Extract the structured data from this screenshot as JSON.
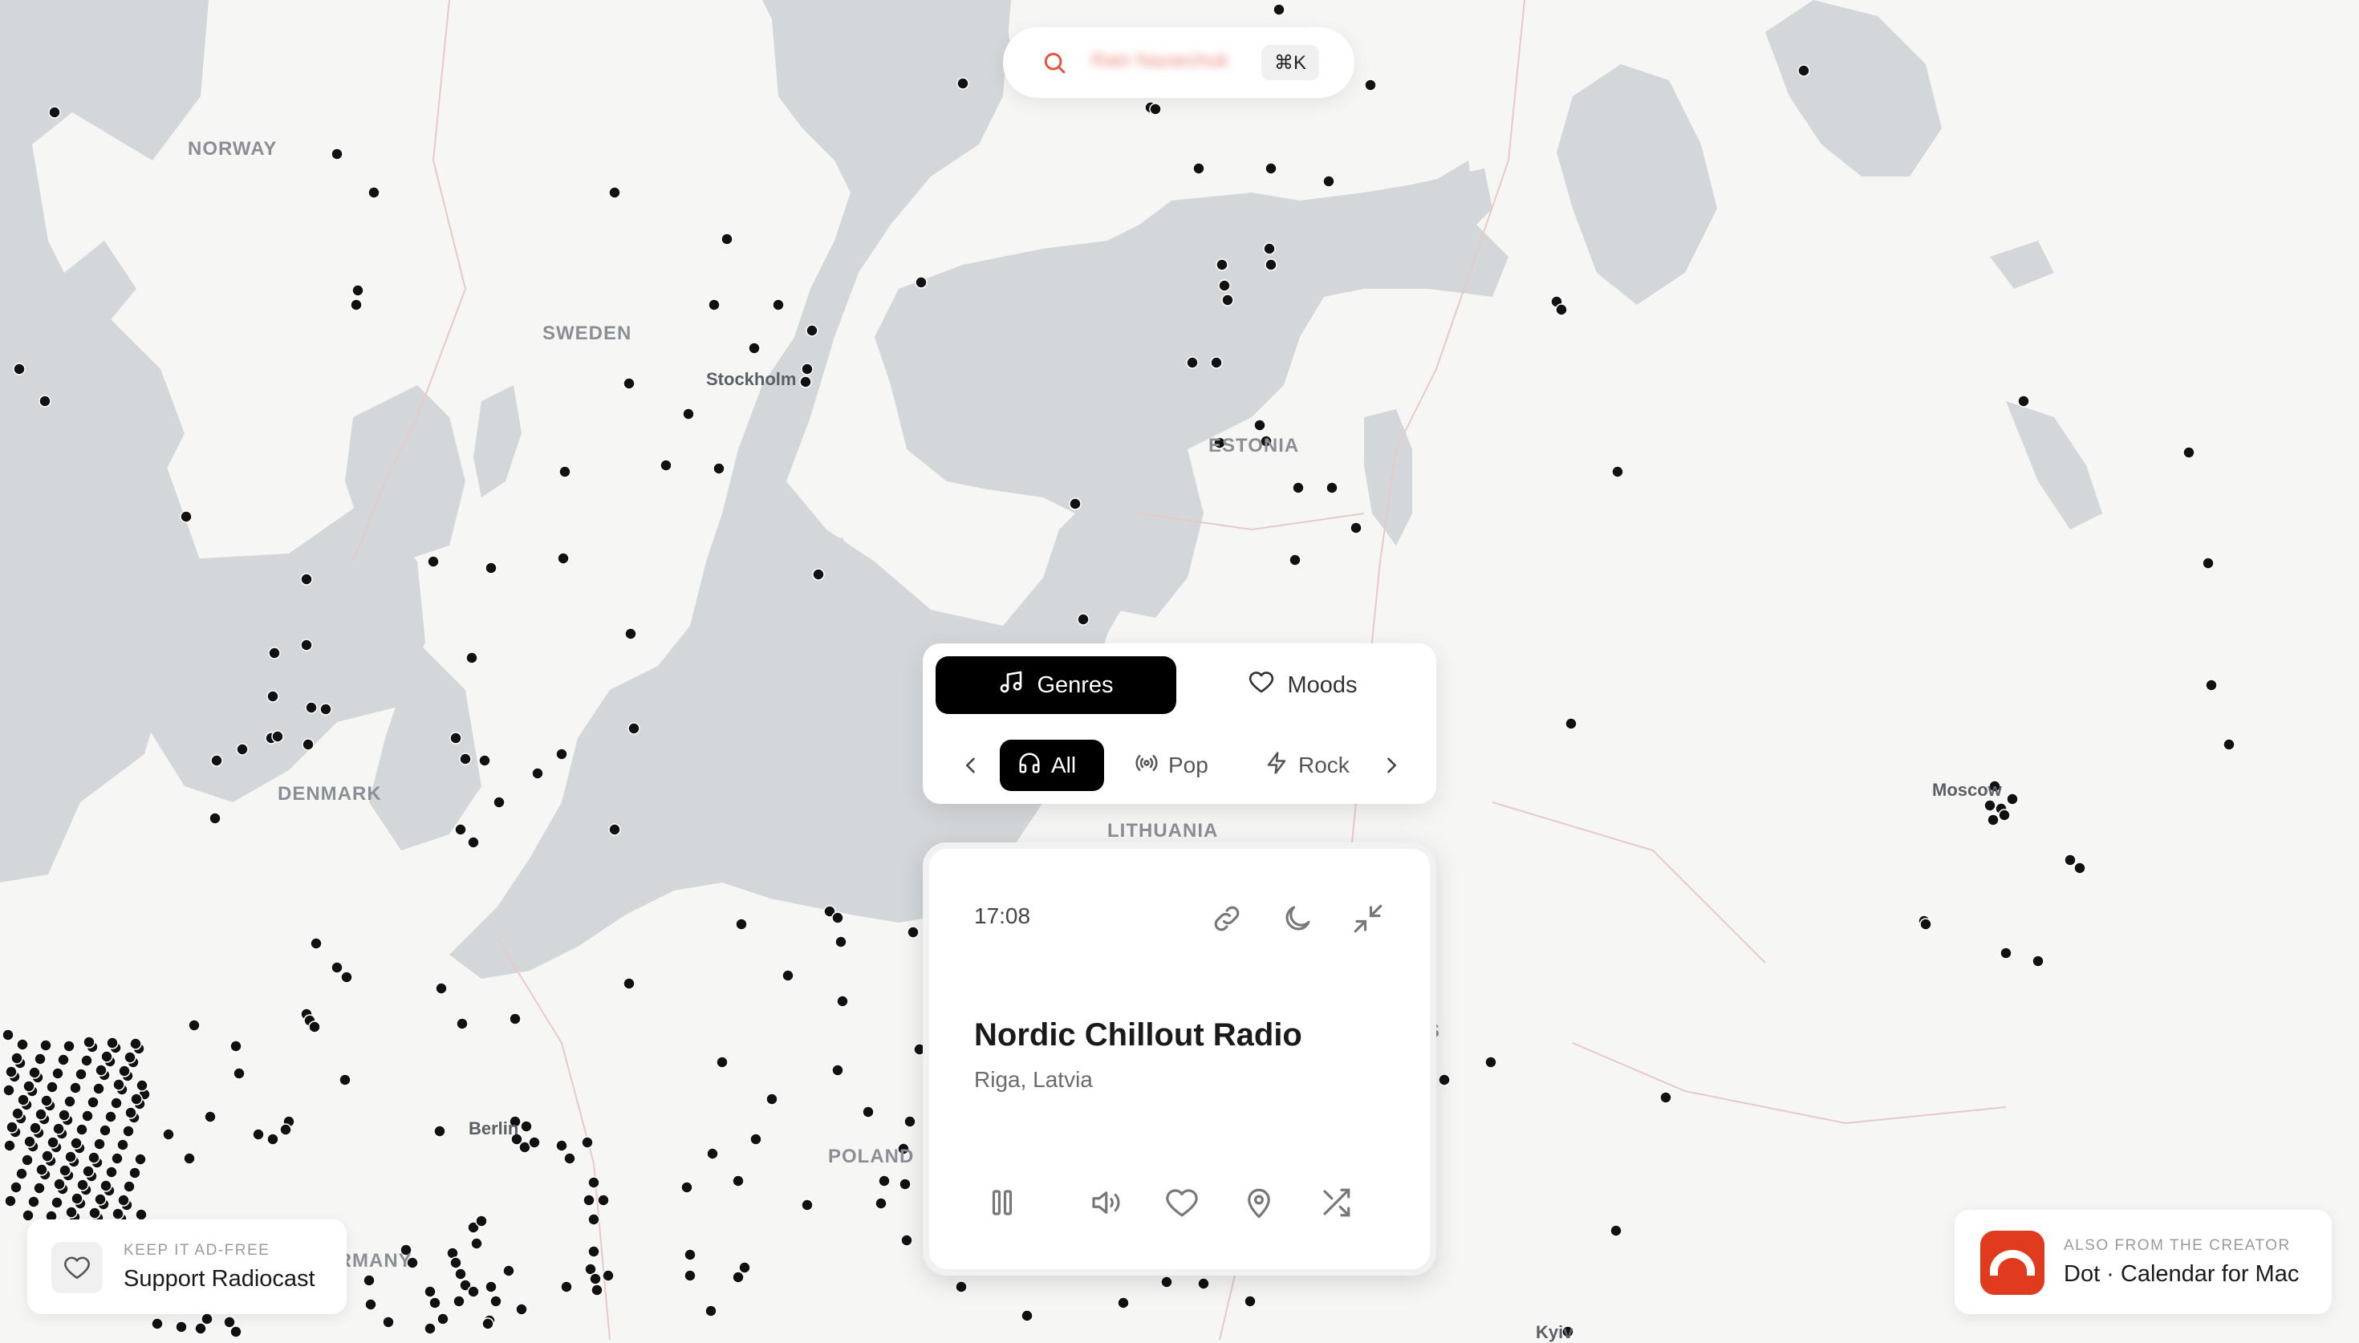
{
  "map": {
    "countries": [
      "NORWAY",
      "SWEDEN",
      "DENMARK",
      "ESTONIA",
      "LITHUANIA",
      "POLAND",
      "GERMANY",
      "S"
    ],
    "cities": [
      "Stockholm",
      "Moscow",
      "Berlin",
      "Kyiv"
    ],
    "colors": {
      "water": "#d3d7da",
      "land": "#f6f6f5",
      "marker": "#111111",
      "border": "#e8c9c9"
    }
  },
  "search": {
    "placeholder": "Rain Nazarchuk",
    "shortcut": "⌘K",
    "icon": "search-icon",
    "icon_color": "#e5533c"
  },
  "genre_panel": {
    "tabs": [
      {
        "label": "Genres",
        "icon": "music-note-icon",
        "active": true
      },
      {
        "label": "Moods",
        "icon": "heart-icon",
        "active": false
      }
    ],
    "chips": [
      {
        "label": "All",
        "icon": "headphones-icon",
        "active": true
      },
      {
        "label": "Pop",
        "icon": "broadcast-icon",
        "active": false
      },
      {
        "label": "Rock",
        "icon": "lightning-icon",
        "active": false
      }
    ]
  },
  "player": {
    "time": "17:08",
    "station": "Nordic Chillout Radio",
    "location": "Riga, Latvia",
    "top_icons": [
      "link-icon",
      "moon-icon",
      "minimize-icon"
    ],
    "controls": [
      "pause-icon",
      "volume-icon",
      "heart-icon",
      "location-pin-icon",
      "shuffle-icon"
    ]
  },
  "support": {
    "caption": "KEEP IT AD-FREE",
    "label": "Support Radiocast"
  },
  "promo": {
    "caption": "ALSO FROM THE CREATOR",
    "label": "Dot · Calendar for Mac",
    "accent": "#e13b1f"
  }
}
